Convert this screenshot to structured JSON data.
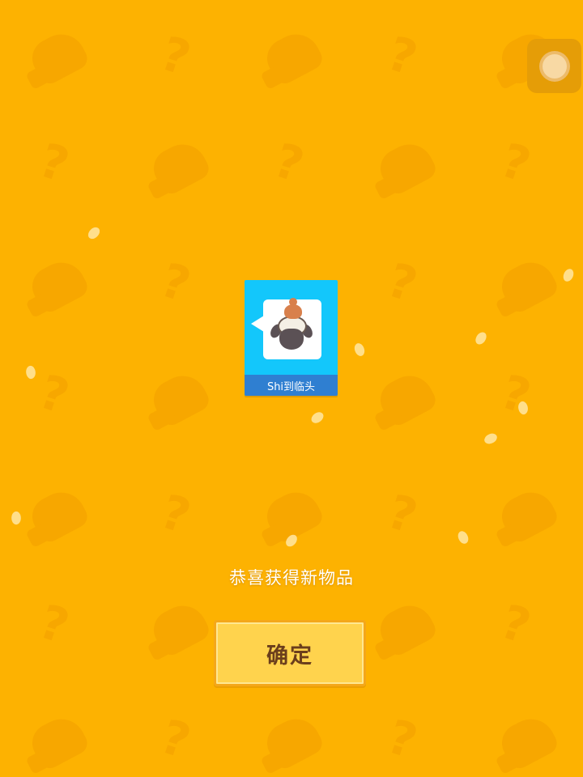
{
  "header": {
    "settings_icon": "gear-icon"
  },
  "reward": {
    "item_name": "Shi到临头",
    "item_icon": "sheep-poop-emoji-icon",
    "message": "恭喜获得新物品"
  },
  "actions": {
    "confirm_label": "确定"
  },
  "colors": {
    "background": "#FDB201",
    "card": "#13C7FB",
    "label_bar": "#2F7FD1",
    "button": "#FFD34D",
    "button_text": "#6B3E1C"
  }
}
